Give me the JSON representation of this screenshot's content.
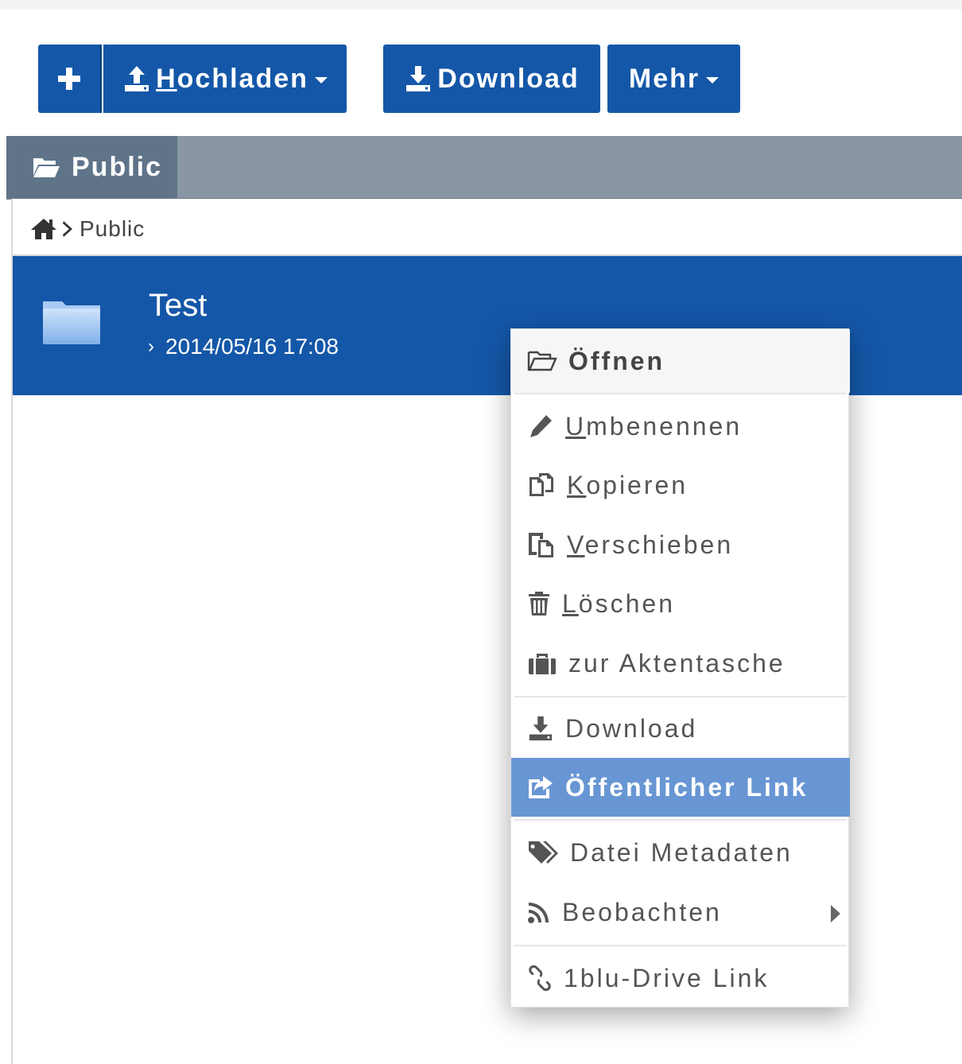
{
  "toolbar": {
    "add_icon": "plus-icon",
    "upload_label": "Hochladen",
    "upload_icon": "upload-icon",
    "download_label": "Download",
    "download_icon": "download-icon",
    "more_label": "Mehr"
  },
  "tabs": {
    "active_label": "Public",
    "active_icon": "folder-open-icon"
  },
  "breadcrumb": {
    "home_icon": "home-icon",
    "current": "Public"
  },
  "file_list": {
    "items": [
      {
        "name": "Test",
        "modified": "2014/05/16 17:08",
        "icon": "folder-icon",
        "selected": true
      }
    ]
  },
  "context_menu": {
    "items": [
      {
        "label": "Öffnen",
        "icon": "folder-open-outline-icon"
      },
      {
        "label": "Umbenennen",
        "icon": "pencil-icon"
      },
      {
        "label": "Kopieren",
        "icon": "copy-icon"
      },
      {
        "label": "Verschieben",
        "icon": "paste-icon"
      },
      {
        "label": "Löschen",
        "icon": "trash-icon"
      },
      {
        "label": "zur Aktentasche",
        "icon": "briefcase-icon"
      },
      {
        "label": "Download",
        "icon": "download-icon"
      },
      {
        "label": "Öffentlicher Link",
        "icon": "share-icon",
        "highlighted": true
      },
      {
        "label": "Datei Metadaten",
        "icon": "tags-icon"
      },
      {
        "label": "Beobachten",
        "icon": "rss-icon",
        "has_submenu": true
      },
      {
        "label": "1blu-Drive Link",
        "icon": "link-icon"
      }
    ]
  },
  "colors": {
    "primary": "#1457a8",
    "tabbar": "#8a96a3",
    "tab_active": "#5f7489",
    "menu_highlight": "#6896d4"
  }
}
